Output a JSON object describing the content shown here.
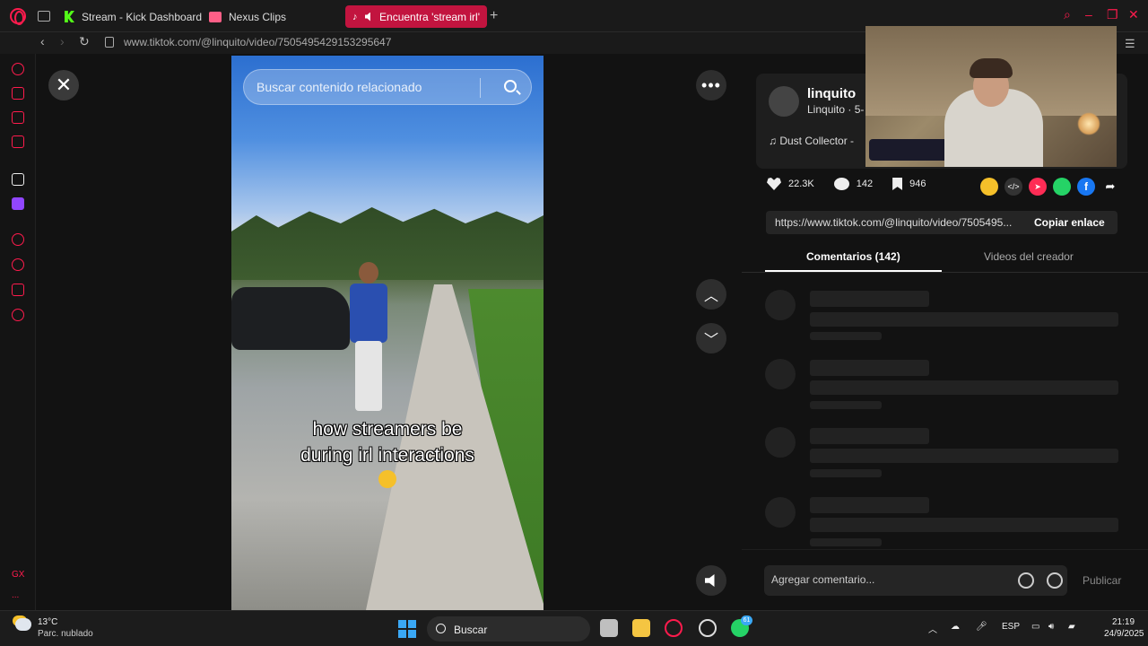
{
  "tabs": [
    {
      "label": "Stream - Kick Dashboard"
    },
    {
      "label": "Nexus Clips"
    },
    {
      "label": "Encuentra 'stream irl'"
    }
  ],
  "address": {
    "url": "www.tiktok.com/@linquito/video/7505495429153295647"
  },
  "sidebar": {
    "gx_label": "GX",
    "more_label": "..."
  },
  "video": {
    "search_placeholder": "Buscar contenido relacionado",
    "caption_line1": "how streamers be",
    "caption_line2": "during irl interactions"
  },
  "author": {
    "username": "linquito",
    "subline": "Linquito · 5-",
    "music": "Dust Collector - ",
    "music_icon": "♫"
  },
  "stats": {
    "likes": "22.3K",
    "comments": "142",
    "saves": "946"
  },
  "share": {
    "url": "https://www.tiktok.com/@linquito/video/7505495...",
    "copy_label": "Copiar enlace"
  },
  "panel_tabs": {
    "comments": "Comentarios (142)",
    "creator": "Videos del creador"
  },
  "comment_box": {
    "placeholder": "Agregar comentario...",
    "publish": "Publicar"
  },
  "taskbar": {
    "temp": "13°C",
    "weather": "Parc. nublado",
    "search": "Buscar",
    "language": "ESP",
    "time": "21:19",
    "date": "24/9/2025",
    "whatsapp_badge": "61"
  },
  "colors": {
    "accent": "#ff1b4d",
    "active_tab": "#c2143f",
    "kick": "#53fc18",
    "twitch": "#9146ff"
  }
}
